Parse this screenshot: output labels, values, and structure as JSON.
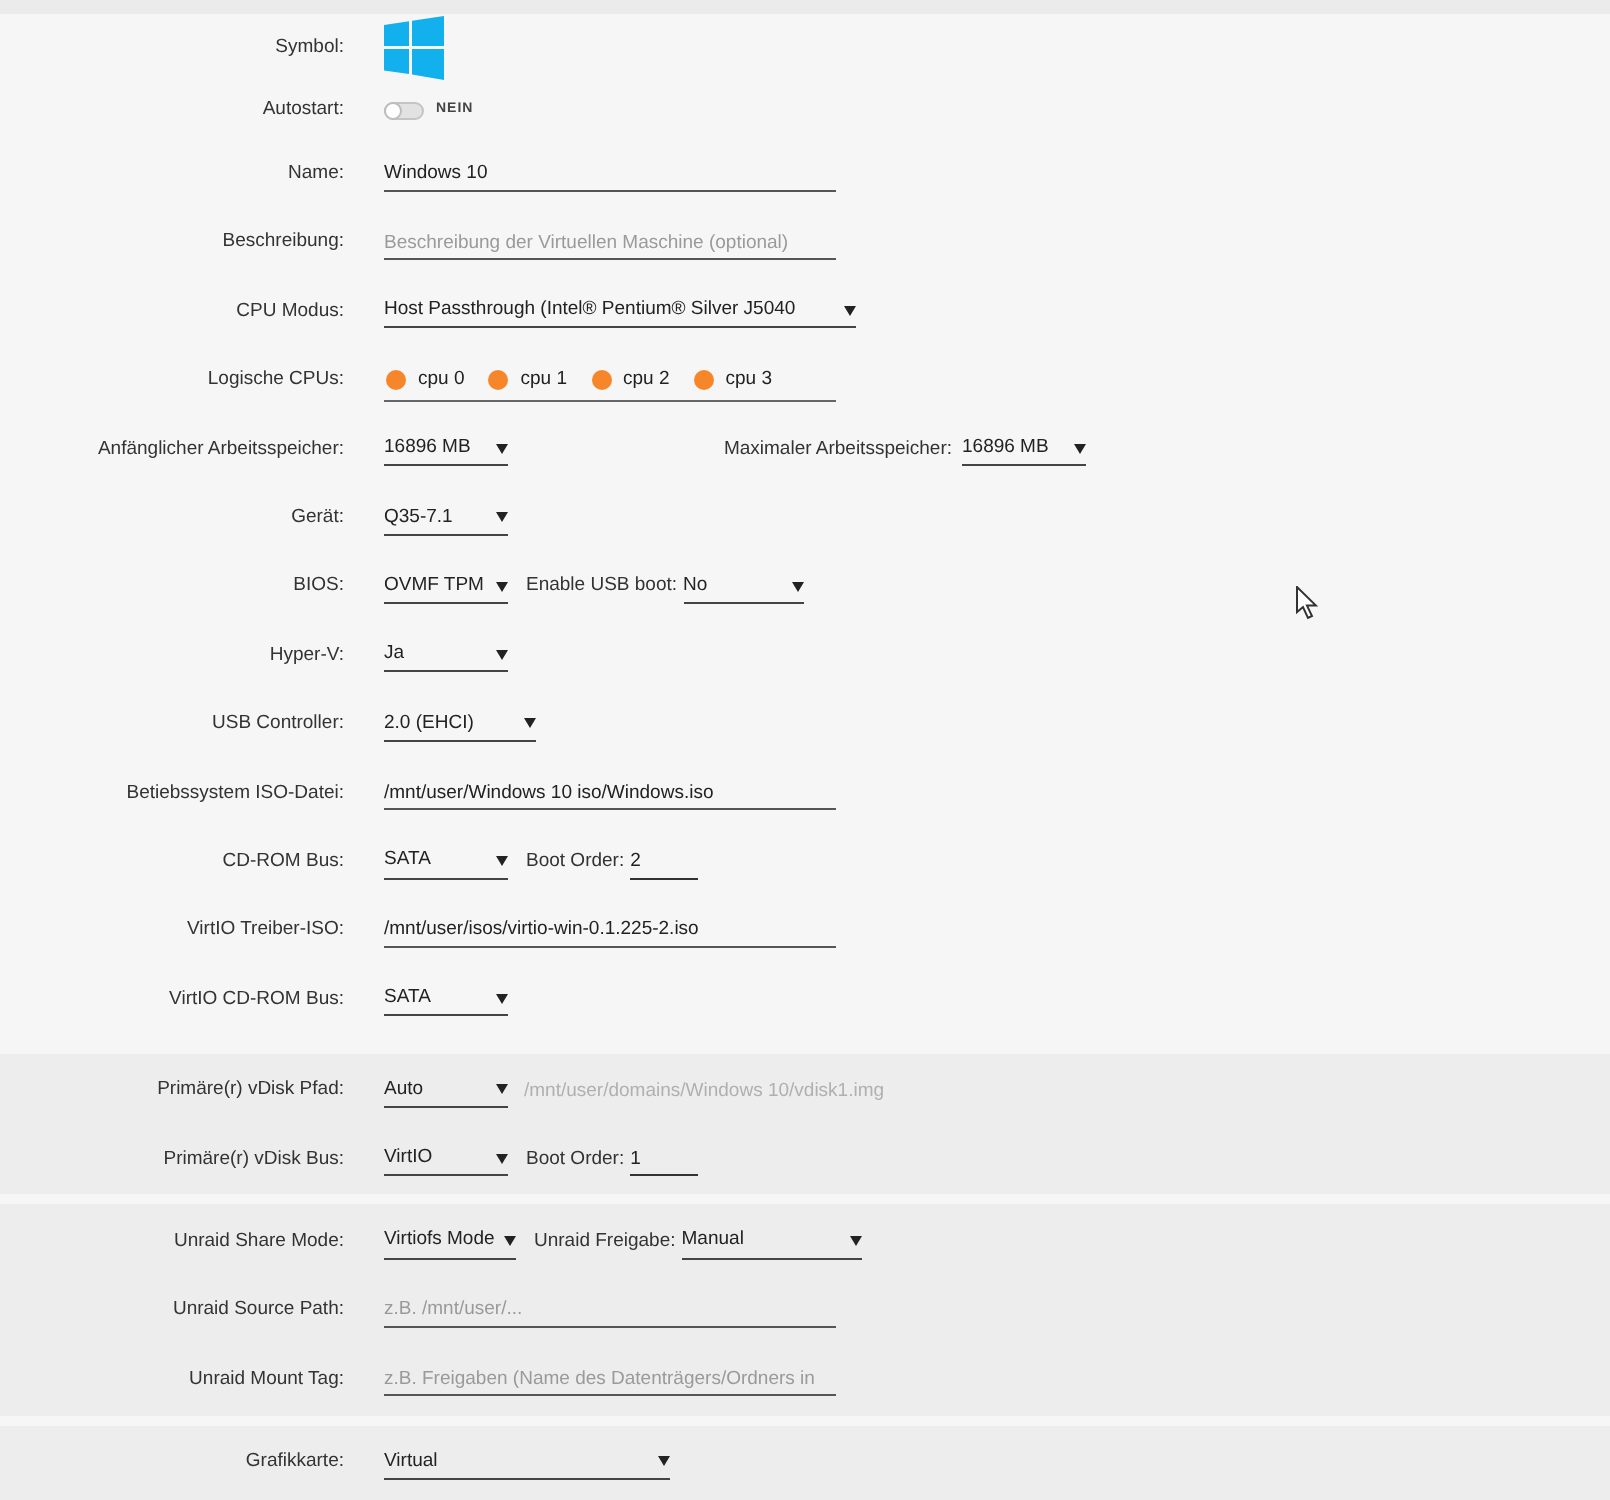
{
  "sections": [
    {
      "rows": [
        {
          "label": "Symbol:",
          "controls": [
            {
              "kind": "logo"
            }
          ]
        },
        {
          "label": "Autostart:",
          "controls": [
            {
              "kind": "toggle",
              "on": false,
              "text": "NEIN"
            }
          ]
        },
        {
          "label": "Name:",
          "controls": [
            {
              "kind": "input",
              "value": "Windows 10",
              "disabled": false
            }
          ]
        },
        {
          "label": "Beschreibung:",
          "controls": [
            {
              "kind": "input",
              "placeholder": "Beschreibung der Virtuellen Maschine (optional)",
              "disabled": false
            }
          ]
        },
        {
          "label": "CPU Modus:",
          "controls": [
            {
              "kind": "select",
              "value": "Host Passthrough (Intel® Pentium® Silver J5040"
            }
          ]
        },
        {
          "label": "Logische CPUs:",
          "controls": [
            {
              "kind": "cpus",
              "items": [
                {
                  "label": "cpu 0",
                  "checked": true
                },
                {
                  "label": "cpu 1",
                  "checked": true
                },
                {
                  "label": "cpu 2",
                  "checked": true
                },
                {
                  "label": "cpu 3",
                  "checked": true
                }
              ]
            }
          ]
        },
        {
          "label": "Anfänglicher Arbeitsspeicher:",
          "controls": [
            {
              "kind": "select",
              "value": "16896 MB"
            },
            {
              "kind": "label",
              "text": "Maximaler Arbeitsspeicher:"
            },
            {
              "kind": "select",
              "value": "16896 MB"
            }
          ]
        },
        {
          "label": "Gerät:",
          "controls": [
            {
              "kind": "select",
              "value": "Q35-7.1"
            }
          ]
        },
        {
          "label": "BIOS:",
          "controls": [
            {
              "kind": "select",
              "value": "OVMF TPM"
            },
            {
              "kind": "label",
              "text": "Enable USB boot:"
            },
            {
              "kind": "select",
              "value": "No"
            }
          ]
        },
        {
          "label": "Hyper-V:",
          "controls": [
            {
              "kind": "select",
              "value": "Ja"
            }
          ]
        },
        {
          "label": "USB Controller:",
          "controls": [
            {
              "kind": "select",
              "value": "2.0 (EHCI)"
            }
          ]
        },
        {
          "label": "Betiebssystem ISO-Datei:",
          "controls": [
            {
              "kind": "input",
              "value": "/mnt/user/Windows 10 iso/Windows.iso",
              "disabled": false
            }
          ]
        },
        {
          "label": "CD-ROM Bus:",
          "controls": [
            {
              "kind": "select",
              "value": "SATA"
            },
            {
              "kind": "label",
              "text": "Boot Order:"
            },
            {
              "kind": "number",
              "value": "2"
            }
          ]
        },
        {
          "label": "VirtIO Treiber-ISO:",
          "controls": [
            {
              "kind": "input",
              "value": "/mnt/user/isos/virtio-win-0.1.225-2.iso",
              "disabled": false
            }
          ]
        },
        {
          "label": "VirtIO CD-ROM Bus:",
          "controls": [
            {
              "kind": "select",
              "value": "SATA"
            }
          ]
        }
      ]
    },
    {
      "rows": [
        {
          "label": "Primäre(r) vDisk Pfad:",
          "controls": [
            {
              "kind": "select",
              "value": "Auto"
            },
            {
              "kind": "input",
              "value": "/mnt/user/domains/Windows 10/vdisk1.img",
              "disabled": true
            }
          ]
        },
        {
          "label": "Primäre(r) vDisk Bus:",
          "controls": [
            {
              "kind": "select",
              "value": "VirtIO"
            },
            {
              "kind": "label",
              "text": "Boot Order:"
            },
            {
              "kind": "number",
              "value": "1"
            }
          ]
        }
      ]
    },
    {
      "rows": [
        {
          "label": "Unraid Share Mode:",
          "controls": [
            {
              "kind": "select",
              "value": "Virtiofs Mode"
            },
            {
              "kind": "label",
              "text": "Unraid Freigabe:"
            },
            {
              "kind": "select",
              "value": "Manual"
            }
          ]
        },
        {
          "label": "Unraid Source Path:",
          "controls": [
            {
              "kind": "input",
              "placeholder": "z.B. /mnt/user/...",
              "disabled": false
            }
          ]
        },
        {
          "label": "Unraid Mount Tag:",
          "controls": [
            {
              "kind": "input",
              "placeholder": "z.B. Freigaben (Name des Datenträgers/Ordners in",
              "disabled": false
            }
          ]
        }
      ]
    },
    {
      "rows": [
        {
          "label": "Grafikkarte:",
          "controls": [
            {
              "kind": "select",
              "value": "Virtual"
            }
          ]
        }
      ]
    }
  ]
}
